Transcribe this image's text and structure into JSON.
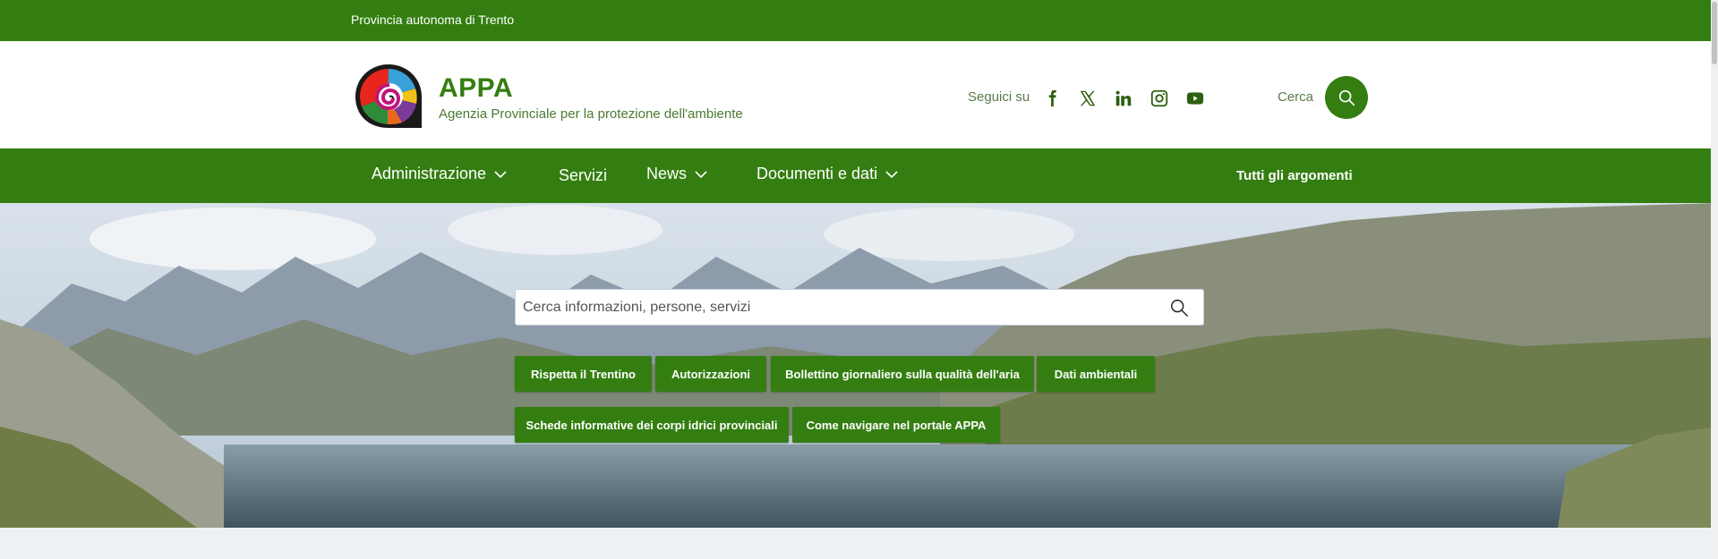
{
  "topbar": {
    "label": "Provincia autonoma di Trento"
  },
  "header": {
    "title": "APPA",
    "subtitle": "Agenzia Provinciale per la protezione dell'ambiente",
    "follow_label": "Seguici su",
    "social": [
      "facebook-icon",
      "x-icon",
      "linkedin-icon",
      "instagram-icon",
      "youtube-icon"
    ],
    "search_label": "Cerca"
  },
  "nav": {
    "items": [
      {
        "label": "Administrazione",
        "has_dropdown": true
      },
      {
        "label": "Servizi",
        "has_dropdown": false
      },
      {
        "label": "News",
        "has_dropdown": true
      },
      {
        "label": "Documenti e dati",
        "has_dropdown": true
      }
    ],
    "all_topics": "Tutti gli argomenti"
  },
  "hero": {
    "search_placeholder": "Cerca informazioni, persone, servizi",
    "chips": [
      "Rispetta il Trentino",
      "Autorizzazioni",
      "Bollettino giornaliero sulla qualità dell'aria",
      "Dati ambientali",
      "Schede informative dei corpi idrici provinciali",
      "Come navigare nel portale APPA"
    ]
  },
  "colors": {
    "brand_green": "#347e11",
    "white": "#ffffff"
  }
}
